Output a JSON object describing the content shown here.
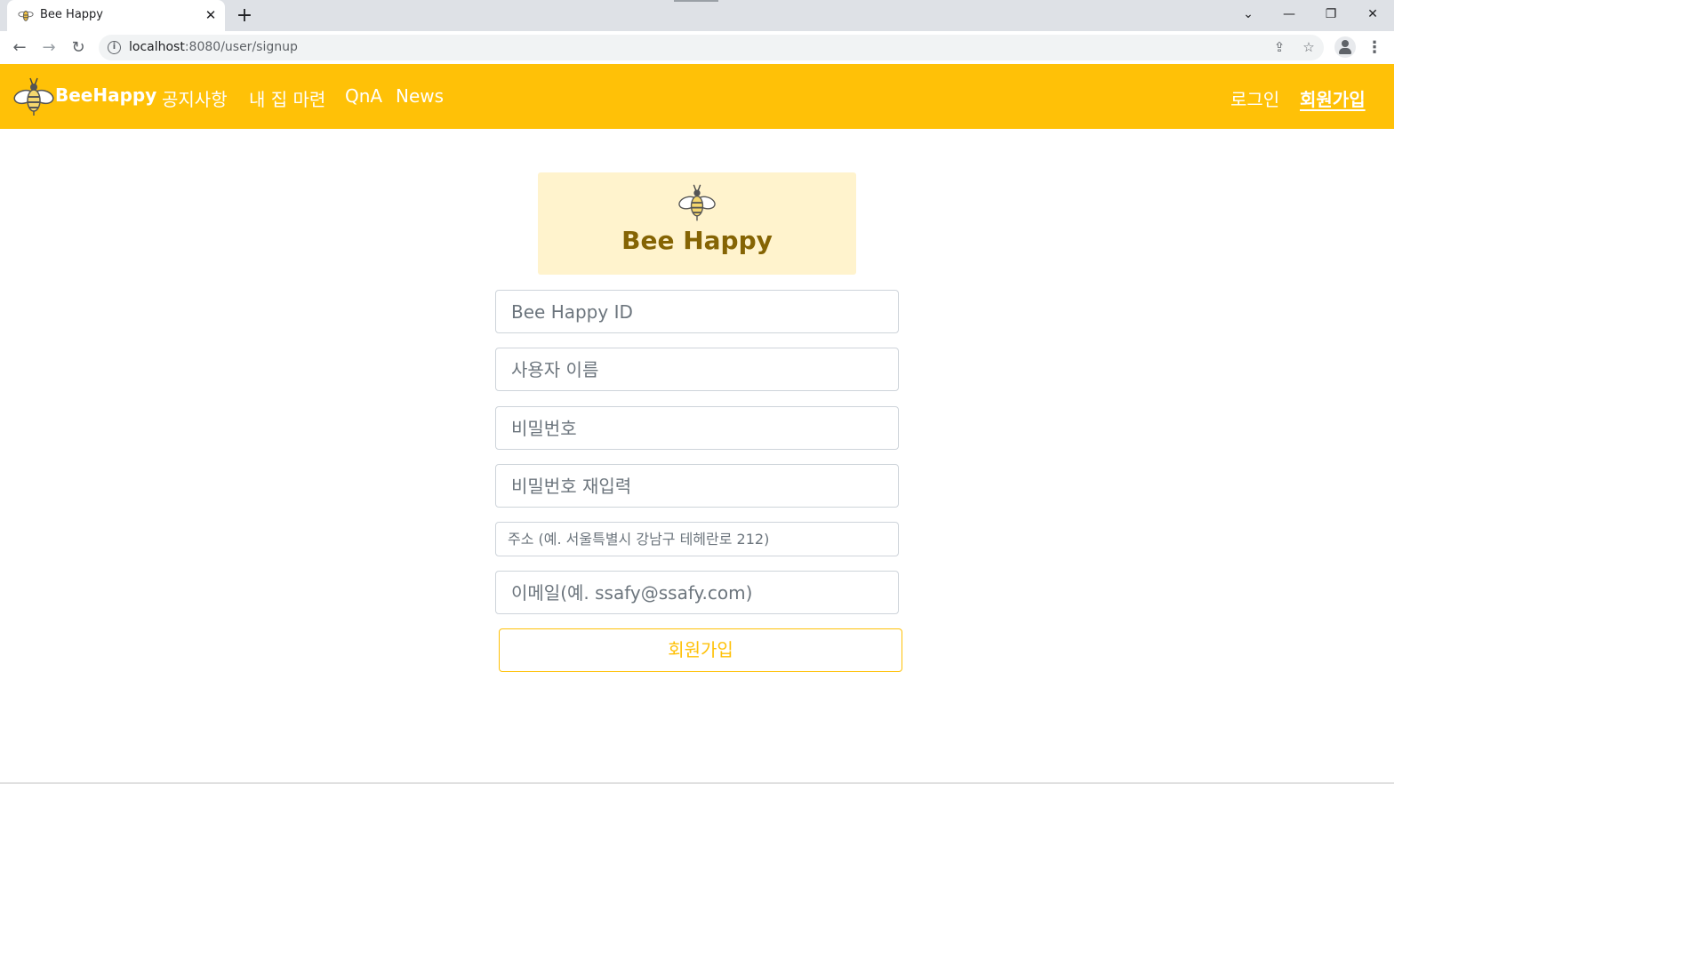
{
  "browser": {
    "tab_title": "Bee Happy",
    "tab_close": "✕",
    "new_tab": "+",
    "url_host": "localhost",
    "url_path": ":8080/user/signup"
  },
  "navbar": {
    "brand": "BeeHappy",
    "links": [
      "공지사항",
      "내 집 마련",
      "QnA",
      "News"
    ],
    "login": "로그인",
    "signup": "회원가입"
  },
  "form": {
    "hero_title": "Bee Happy",
    "id_placeholder": "Bee Happy ID",
    "name_placeholder": "사용자 이름",
    "password_placeholder": "비밀번호",
    "password_confirm_placeholder": "비밀번호 재입력",
    "address_placeholder": "주소 (예. 서울특별시 강남구 테헤란로 212)",
    "email_placeholder": "이메일(예. ssafy@ssafy.com)",
    "submit_label": "회원가입"
  },
  "colors": {
    "primary": "#ffc107",
    "hero_bg": "#fff3cd",
    "hero_text": "#856404"
  }
}
